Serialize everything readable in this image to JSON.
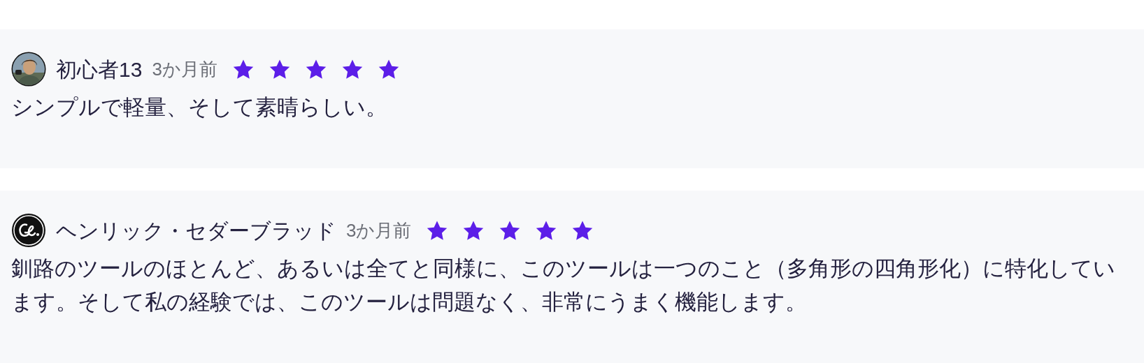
{
  "reviews": [
    {
      "author": "初心者13",
      "time": "3か月前",
      "stars": 5,
      "text": "シンプルで軽量、そして素晴らしい。"
    },
    {
      "avatar": {
        "kind": "logo"
      },
      "author": "ヘンリック・セダーブラッド",
      "time": "3か月前",
      "stars": 5,
      "text": "釧路のツールのほとんど、あるいは全てと同様に、このツールは一つのこと（多角形の四角形化）に特化しています。そして私の経験では、このツールは問題なく、非常にうまく機能します。"
    }
  ]
}
